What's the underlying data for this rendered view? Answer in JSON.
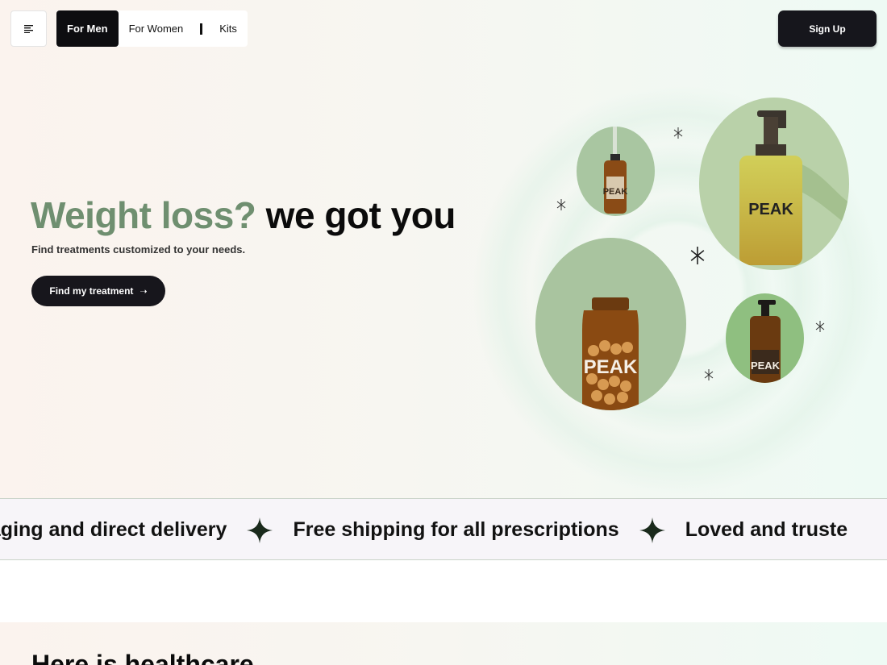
{
  "nav": {
    "menu_icon": "menu-lines-icon",
    "items": [
      {
        "label": "For Men",
        "active": true
      },
      {
        "label": "For Women"
      },
      {
        "label": "Kits"
      }
    ],
    "signup_label": "Sign Up"
  },
  "hero": {
    "headline_green": "Weight loss?",
    "headline_black": "we got you",
    "subline": "Find treatments customized to your needs.",
    "cta_label": "Find my treatment",
    "cta_icon": "arrow-right-icon",
    "brand": "PEAK"
  },
  "marquee": {
    "items": [
      "kaging and direct delivery",
      "Free shipping for all prescriptions",
      "Loved and truste"
    ],
    "separator_icon": "four-point-star-icon"
  },
  "next_section": {
    "title": "Here is healthcare"
  },
  "colors": {
    "accent_green": "#6f8f70",
    "dark": "#16161c"
  }
}
